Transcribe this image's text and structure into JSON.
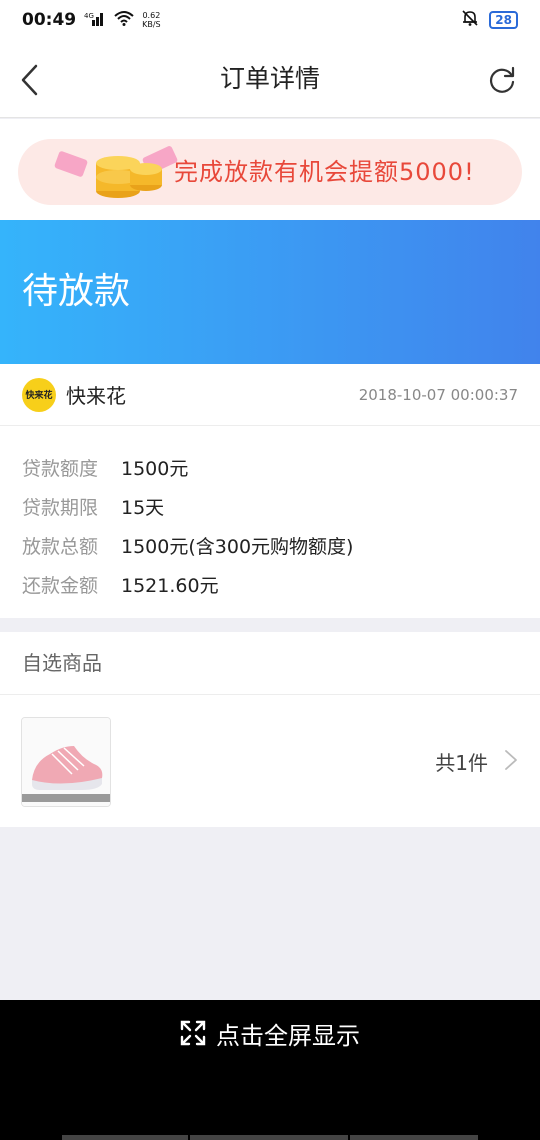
{
  "status_bar": {
    "time": "00:49",
    "network": "4G",
    "speed_value": "0.62",
    "speed_unit": "KB/S",
    "battery": "28"
  },
  "nav": {
    "title": "订单详情"
  },
  "banner": {
    "text": "完成放款有机会提额5000!"
  },
  "order_status": "待放款",
  "merchant": {
    "logo_text": "快来花",
    "name": "快来花",
    "time": "2018-10-07 00:00:37"
  },
  "details": [
    {
      "label": "贷款额度",
      "value": "1500元"
    },
    {
      "label": "贷款期限",
      "value": "15天"
    },
    {
      "label": "放款总额",
      "value": "1500元(含300元购物额度)"
    },
    {
      "label": "还款金额",
      "value": "1521.60元"
    }
  ],
  "products": {
    "title": "自选商品",
    "count": "共1件"
  },
  "bottom": {
    "fullscreen_label": "点击全屏显示"
  },
  "colors": {
    "header_start": "#35b4fb",
    "header_end": "#4183ec",
    "banner_text": "#e8483a",
    "merchant_logo": "#f7cf1a"
  }
}
